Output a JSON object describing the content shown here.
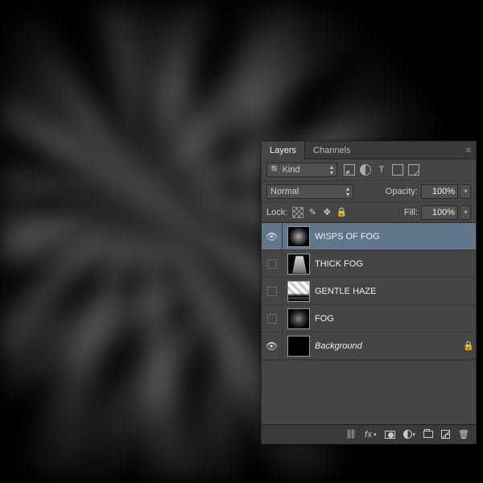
{
  "tabs": {
    "layers": "Layers",
    "channels": "Channels"
  },
  "filter_row": {
    "kind": "Kind"
  },
  "blend_row": {
    "mode": "Normal",
    "opacity_label": "Opacity:",
    "opacity_value": "100%"
  },
  "lock_row": {
    "lock_label": "Lock:",
    "fill_label": "Fill:",
    "fill_value": "100%"
  },
  "layers": [
    {
      "name": "WISPS OF FOG",
      "visible": true,
      "selected": true,
      "thumb": "fog",
      "italic": false,
      "locked": false
    },
    {
      "name": "THICK FOG",
      "visible": false,
      "selected": false,
      "thumb": "thick",
      "italic": false,
      "locked": false
    },
    {
      "name": "GENTLE HAZE",
      "visible": false,
      "selected": false,
      "thumb": "haze",
      "italic": false,
      "locked": false
    },
    {
      "name": "FOG",
      "visible": false,
      "selected": false,
      "thumb": "fog2",
      "italic": false,
      "locked": false
    },
    {
      "name": "Background",
      "visible": true,
      "selected": false,
      "thumb": "black",
      "italic": true,
      "locked": true
    }
  ],
  "footer": {
    "fx": "fx"
  },
  "icons": {
    "menu": "≡",
    "search": "🔍",
    "eye": "👁",
    "brush": "✎",
    "move": "✥",
    "lock": "🔒",
    "link": "⛓",
    "trash": "🗑",
    "t": "T",
    "down": "▾",
    "updn_up": "▴",
    "updn_dn": "▾"
  }
}
